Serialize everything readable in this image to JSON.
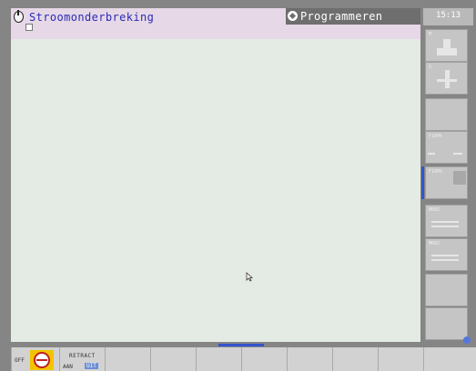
{
  "header": {
    "title": "Stroomonderbreking",
    "mode": "Programmeren",
    "clock": "15:13"
  },
  "softkeys_bottom": {
    "off_label": "OFF",
    "retract_title": "RETRACT",
    "retract_on": "AAN",
    "retract_off": "UIT"
  },
  "icons": {
    "power": "power-icon",
    "mode": "edit-mode-icon",
    "retract": "retract-icon",
    "cursor": "mouse-cursor-icon"
  },
  "colors": {
    "title_text": "#2a2ab8",
    "header_bg": "#e6d8e6",
    "main_bg": "#e3ebe4",
    "accent": "#3355cc",
    "off_highlight": "#6b8fd6"
  }
}
